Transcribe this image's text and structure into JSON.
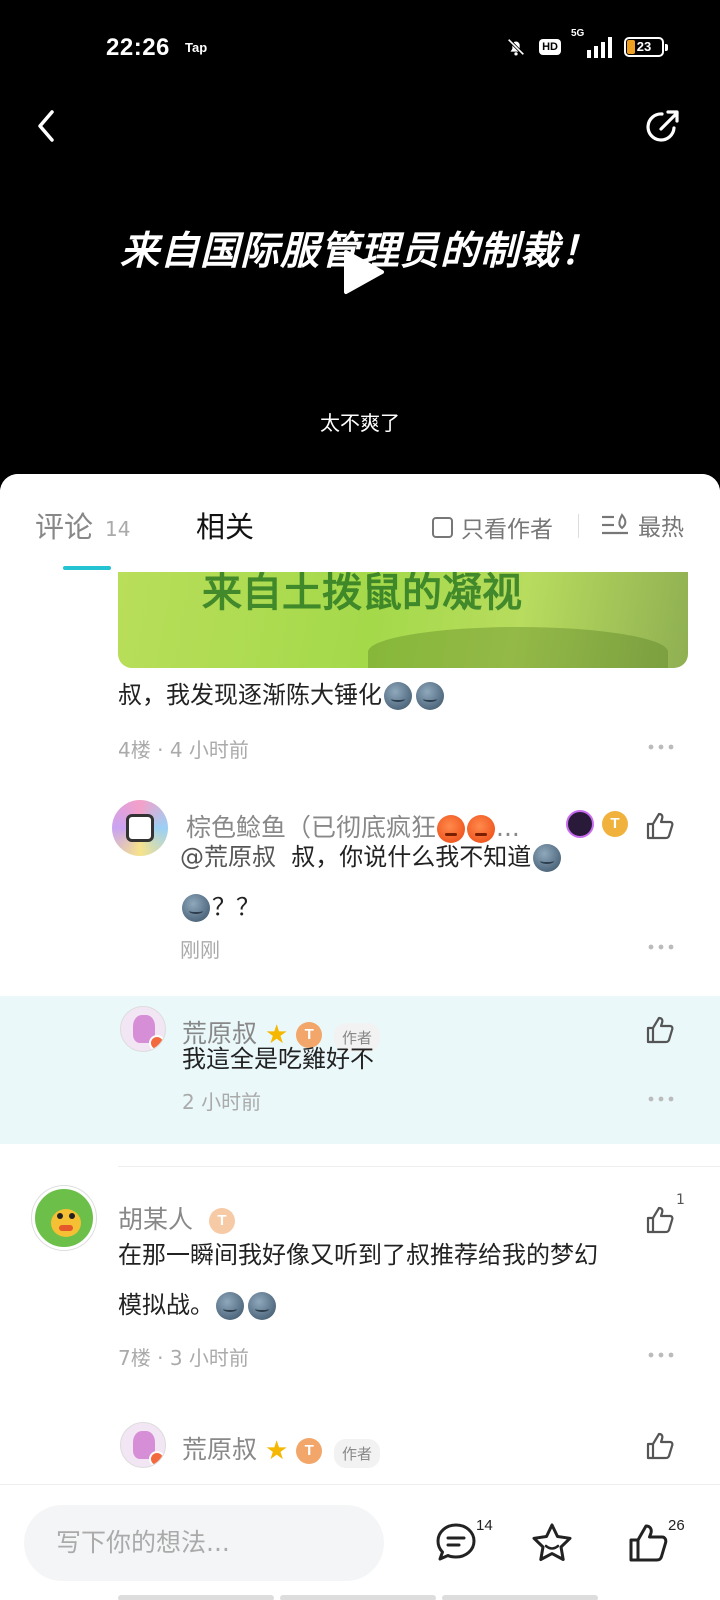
{
  "status_bar": {
    "time": "22:26",
    "app_indicator": "Tap",
    "hd": "HD",
    "network": "5G",
    "battery": "23"
  },
  "video": {
    "title": "来自国际服管理员的制裁！",
    "subtitle": "太不爽了"
  },
  "tabs": {
    "comments_label": "评论",
    "comments_count": "14",
    "related_label": "相关",
    "author_only_label": "只看作者",
    "sort_label": "最热"
  },
  "image_overlay_text": "来自土拨鼠的凝视",
  "comment_4": {
    "text": "叔，我发现逐渐陈大锤化",
    "floor": "4楼",
    "time": "4 小时前",
    "replies": [
      {
        "name": "棕色鲶鱼（已彻底疯狂",
        "ellipsis": "...",
        "level": "T",
        "mention": "@荒原叔",
        "text": "叔，你说什么我不知道",
        "text_tail": "？？",
        "time": "刚刚"
      },
      {
        "name": "荒原叔",
        "level": "T",
        "author_tag": "作者",
        "text": "我這全是吃雞好不",
        "time": "2 小时前"
      }
    ]
  },
  "comment_7": {
    "name": "胡某人",
    "level": "T",
    "like_count": "1",
    "text_line1": "在那一瞬间我好像又听到了叔推荐给我的梦幻",
    "text_line2": "模拟战。",
    "floor": "7楼",
    "time": "3 小时前",
    "reply": {
      "name": "荒原叔",
      "level": "T",
      "author_tag": "作者"
    }
  },
  "bottom_bar": {
    "placeholder": "写下你的想法...",
    "comment_count": "14",
    "like_count": "26"
  },
  "colors": {
    "accent": "#23c3d2",
    "highlight_bg": "#eaf8fa",
    "video_bg": "#000000"
  }
}
